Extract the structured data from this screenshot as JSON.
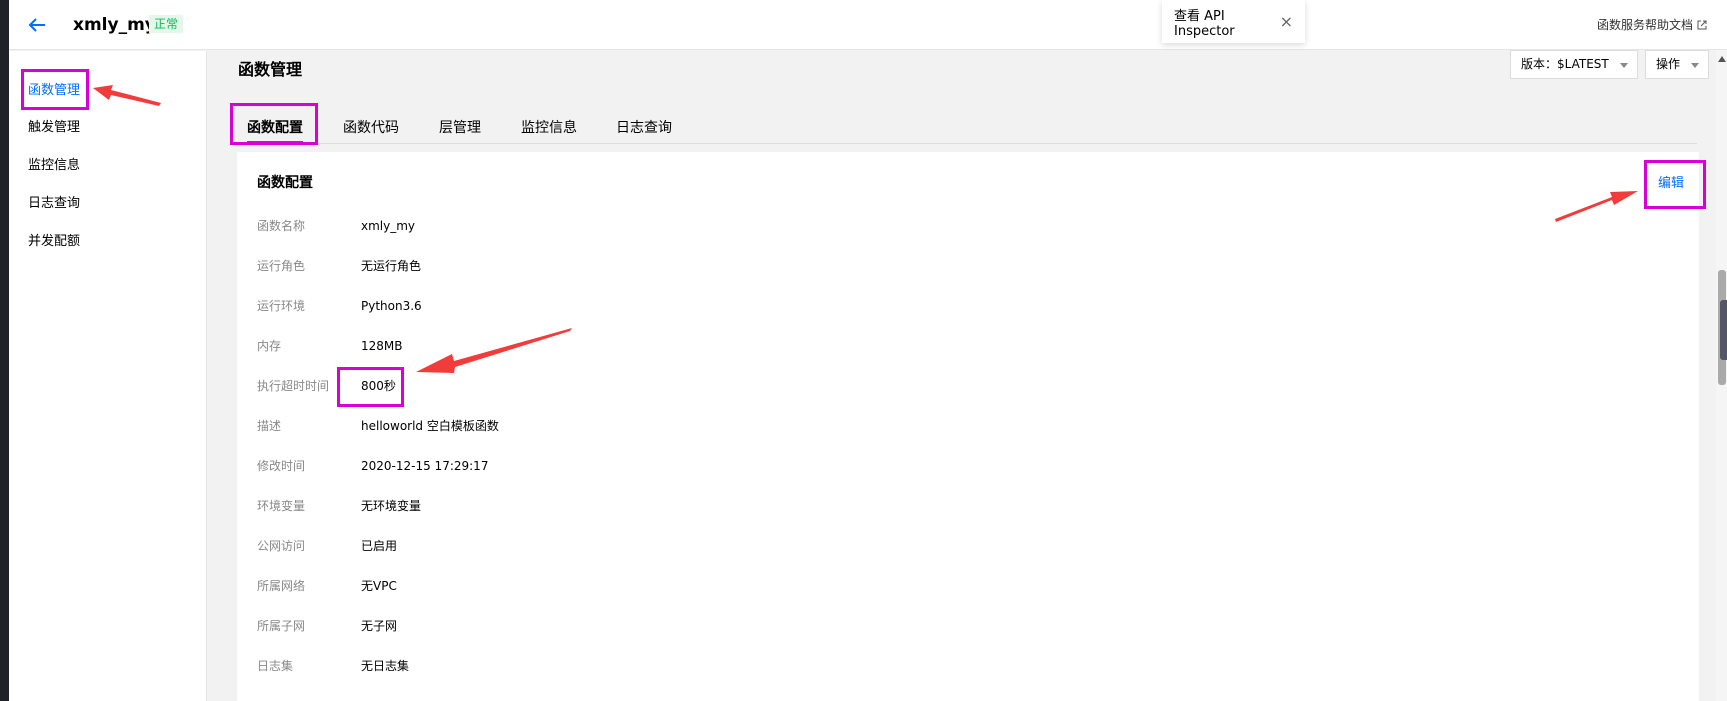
{
  "header": {
    "function_name": "xmly_my",
    "status": "正常",
    "api_inspector_label": "查看 API Inspector",
    "api_inspector_close": "×",
    "help_doc_label": "函数服务帮助文档"
  },
  "sidebar": {
    "items": [
      {
        "label": "函数管理",
        "active": true
      },
      {
        "label": "触发管理",
        "active": false
      },
      {
        "label": "监控信息",
        "active": false
      },
      {
        "label": "日志查询",
        "active": false
      },
      {
        "label": "并发配额",
        "active": false
      }
    ]
  },
  "main": {
    "page_title": "函数管理",
    "version_label": "版本：$LATEST",
    "ops_label": "操作",
    "tabs": [
      {
        "label": "函数配置",
        "active": true
      },
      {
        "label": "函数代码",
        "active": false
      },
      {
        "label": "层管理",
        "active": false
      },
      {
        "label": "监控信息",
        "active": false
      },
      {
        "label": "日志查询",
        "active": false
      }
    ],
    "config": {
      "title": "函数配置",
      "edit_label": "编辑",
      "rows": [
        {
          "key": "函数名称",
          "value": "xmly_my"
        },
        {
          "key": "运行角色",
          "value": "无运行角色"
        },
        {
          "key": "运行环境",
          "value": "Python3.6"
        },
        {
          "key": "内存",
          "value": "128MB"
        },
        {
          "key": "执行超时时间",
          "value": "800秒"
        },
        {
          "key": "描述",
          "value": "helloworld 空白模板函数"
        },
        {
          "key": "修改时间",
          "value": "2020-12-15 17:29:17"
        },
        {
          "key": "环境变量",
          "value": "无环境变量"
        },
        {
          "key": "公网访问",
          "value": "已启用"
        },
        {
          "key": "所属网络",
          "value": "无VPC"
        },
        {
          "key": "所属子网",
          "value": "无子网"
        },
        {
          "key": "日志集",
          "value": "无日志集"
        }
      ]
    }
  },
  "colors": {
    "accent": "#006eff",
    "annotation_box": "#d700d7",
    "annotation_arrow": "#f23c3c",
    "status_green": "#0abf5b"
  }
}
